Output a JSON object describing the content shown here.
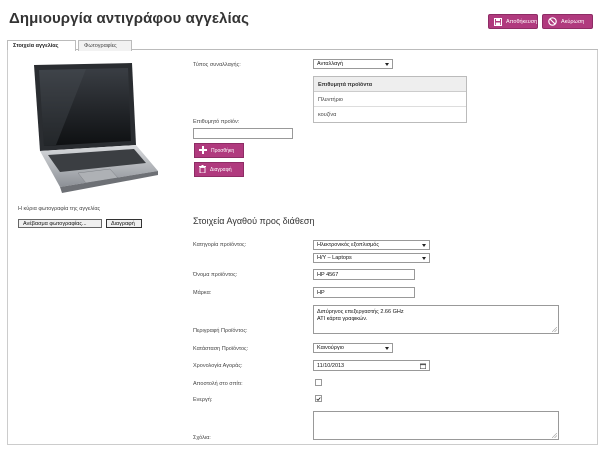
{
  "page": {
    "title": "Δημιουργία αντιγράφου αγγελίας"
  },
  "toolbar": {
    "save_label": "Αποθήκευση",
    "cancel_label": "Ακύρωση"
  },
  "tabs": [
    {
      "label": "Στοιχεία αγγελίας",
      "active": true
    },
    {
      "label": "Φωτογραφίες",
      "active": false
    }
  ],
  "photo": {
    "caption": "Η κύρια φωτογραφία της αγγελίας",
    "upload_label": "Ανέβασμα φωτογραφίας...",
    "delete_label": "Διαγραφή"
  },
  "trade": {
    "type_label": "Τύπος συναλλαγής:",
    "type_value": "Ανταλλαγή",
    "wanted_header": "Επιθυμητά προϊόντα",
    "wanted_items": [
      "Πλυντήριο",
      "κουζίνα"
    ],
    "wanted_product_label": "Επιθυμητό προϊόν:",
    "wanted_product_value": "",
    "add_label": "Προσθήκη",
    "remove_label": "Διαγραφή"
  },
  "item": {
    "section_title": "Στοιχεία Αγαθού προς διάθεση",
    "category_label": "Κατηγορία προϊόντος:",
    "category_value": "Ηλεκτρονικός εξοπλισμός",
    "subcategory_value": "Η/Υ – Laptops",
    "name_label": "Όνομα προϊόντος:",
    "name_value": "HP 4567",
    "brand_label": "Μάρκα:",
    "brand_value": "HP",
    "description_label": "Περιγραφή Προϊόντος:",
    "description_line1": "Διπύρηνος επεξεργαστής 2.66 GHz",
    "description_line2": "ATI κάρτα γραφικών.",
    "condition_label": "Κατάσταση Προϊόντος:",
    "condition_value": "Καινούργιο",
    "date_label": "Χρονολογία Αγοράς:",
    "date_value": "11/10/2013",
    "shipping_label": "Αποστολή στο σπίτι:",
    "shipping_checked": false,
    "active_label": "Ενεργή:",
    "active_checked": true,
    "comments_label": "Σχόλια:",
    "comments_value": ""
  },
  "colors": {
    "accent": "#b03a7e"
  },
  "icons": [
    "floppy-icon",
    "no-entry-icon",
    "plus-icon",
    "trash-icon",
    "calendar-icon",
    "checkmark-icon"
  ]
}
